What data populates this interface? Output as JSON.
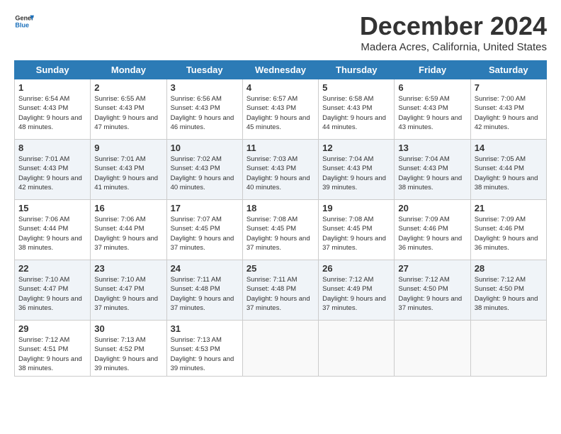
{
  "header": {
    "logo_line1": "General",
    "logo_line2": "Blue",
    "month_year": "December 2024",
    "location": "Madera Acres, California, United States"
  },
  "columns": [
    "Sunday",
    "Monday",
    "Tuesday",
    "Wednesday",
    "Thursday",
    "Friday",
    "Saturday"
  ],
  "rows": [
    [
      {
        "date": "1",
        "sunrise": "Sunrise: 6:54 AM",
        "sunset": "Sunset: 4:43 PM",
        "daylight": "Daylight: 9 hours and 48 minutes."
      },
      {
        "date": "2",
        "sunrise": "Sunrise: 6:55 AM",
        "sunset": "Sunset: 4:43 PM",
        "daylight": "Daylight: 9 hours and 47 minutes."
      },
      {
        "date": "3",
        "sunrise": "Sunrise: 6:56 AM",
        "sunset": "Sunset: 4:43 PM",
        "daylight": "Daylight: 9 hours and 46 minutes."
      },
      {
        "date": "4",
        "sunrise": "Sunrise: 6:57 AM",
        "sunset": "Sunset: 4:43 PM",
        "daylight": "Daylight: 9 hours and 45 minutes."
      },
      {
        "date": "5",
        "sunrise": "Sunrise: 6:58 AM",
        "sunset": "Sunset: 4:43 PM",
        "daylight": "Daylight: 9 hours and 44 minutes."
      },
      {
        "date": "6",
        "sunrise": "Sunrise: 6:59 AM",
        "sunset": "Sunset: 4:43 PM",
        "daylight": "Daylight: 9 hours and 43 minutes."
      },
      {
        "date": "7",
        "sunrise": "Sunrise: 7:00 AM",
        "sunset": "Sunset: 4:43 PM",
        "daylight": "Daylight: 9 hours and 42 minutes."
      }
    ],
    [
      {
        "date": "8",
        "sunrise": "Sunrise: 7:01 AM",
        "sunset": "Sunset: 4:43 PM",
        "daylight": "Daylight: 9 hours and 42 minutes."
      },
      {
        "date": "9",
        "sunrise": "Sunrise: 7:01 AM",
        "sunset": "Sunset: 4:43 PM",
        "daylight": "Daylight: 9 hours and 41 minutes."
      },
      {
        "date": "10",
        "sunrise": "Sunrise: 7:02 AM",
        "sunset": "Sunset: 4:43 PM",
        "daylight": "Daylight: 9 hours and 40 minutes."
      },
      {
        "date": "11",
        "sunrise": "Sunrise: 7:03 AM",
        "sunset": "Sunset: 4:43 PM",
        "daylight": "Daylight: 9 hours and 40 minutes."
      },
      {
        "date": "12",
        "sunrise": "Sunrise: 7:04 AM",
        "sunset": "Sunset: 4:43 PM",
        "daylight": "Daylight: 9 hours and 39 minutes."
      },
      {
        "date": "13",
        "sunrise": "Sunrise: 7:04 AM",
        "sunset": "Sunset: 4:43 PM",
        "daylight": "Daylight: 9 hours and 38 minutes."
      },
      {
        "date": "14",
        "sunrise": "Sunrise: 7:05 AM",
        "sunset": "Sunset: 4:44 PM",
        "daylight": "Daylight: 9 hours and 38 minutes."
      }
    ],
    [
      {
        "date": "15",
        "sunrise": "Sunrise: 7:06 AM",
        "sunset": "Sunset: 4:44 PM",
        "daylight": "Daylight: 9 hours and 38 minutes."
      },
      {
        "date": "16",
        "sunrise": "Sunrise: 7:06 AM",
        "sunset": "Sunset: 4:44 PM",
        "daylight": "Daylight: 9 hours and 37 minutes."
      },
      {
        "date": "17",
        "sunrise": "Sunrise: 7:07 AM",
        "sunset": "Sunset: 4:45 PM",
        "daylight": "Daylight: 9 hours and 37 minutes."
      },
      {
        "date": "18",
        "sunrise": "Sunrise: 7:08 AM",
        "sunset": "Sunset: 4:45 PM",
        "daylight": "Daylight: 9 hours and 37 minutes."
      },
      {
        "date": "19",
        "sunrise": "Sunrise: 7:08 AM",
        "sunset": "Sunset: 4:45 PM",
        "daylight": "Daylight: 9 hours and 37 minutes."
      },
      {
        "date": "20",
        "sunrise": "Sunrise: 7:09 AM",
        "sunset": "Sunset: 4:46 PM",
        "daylight": "Daylight: 9 hours and 36 minutes."
      },
      {
        "date": "21",
        "sunrise": "Sunrise: 7:09 AM",
        "sunset": "Sunset: 4:46 PM",
        "daylight": "Daylight: 9 hours and 36 minutes."
      }
    ],
    [
      {
        "date": "22",
        "sunrise": "Sunrise: 7:10 AM",
        "sunset": "Sunset: 4:47 PM",
        "daylight": "Daylight: 9 hours and 36 minutes."
      },
      {
        "date": "23",
        "sunrise": "Sunrise: 7:10 AM",
        "sunset": "Sunset: 4:47 PM",
        "daylight": "Daylight: 9 hours and 37 minutes."
      },
      {
        "date": "24",
        "sunrise": "Sunrise: 7:11 AM",
        "sunset": "Sunset: 4:48 PM",
        "daylight": "Daylight: 9 hours and 37 minutes."
      },
      {
        "date": "25",
        "sunrise": "Sunrise: 7:11 AM",
        "sunset": "Sunset: 4:48 PM",
        "daylight": "Daylight: 9 hours and 37 minutes."
      },
      {
        "date": "26",
        "sunrise": "Sunrise: 7:12 AM",
        "sunset": "Sunset: 4:49 PM",
        "daylight": "Daylight: 9 hours and 37 minutes."
      },
      {
        "date": "27",
        "sunrise": "Sunrise: 7:12 AM",
        "sunset": "Sunset: 4:50 PM",
        "daylight": "Daylight: 9 hours and 37 minutes."
      },
      {
        "date": "28",
        "sunrise": "Sunrise: 7:12 AM",
        "sunset": "Sunset: 4:50 PM",
        "daylight": "Daylight: 9 hours and 38 minutes."
      }
    ],
    [
      {
        "date": "29",
        "sunrise": "Sunrise: 7:12 AM",
        "sunset": "Sunset: 4:51 PM",
        "daylight": "Daylight: 9 hours and 38 minutes."
      },
      {
        "date": "30",
        "sunrise": "Sunrise: 7:13 AM",
        "sunset": "Sunset: 4:52 PM",
        "daylight": "Daylight: 9 hours and 39 minutes."
      },
      {
        "date": "31",
        "sunrise": "Sunrise: 7:13 AM",
        "sunset": "Sunset: 4:53 PM",
        "daylight": "Daylight: 9 hours and 39 minutes."
      },
      null,
      null,
      null,
      null
    ]
  ]
}
